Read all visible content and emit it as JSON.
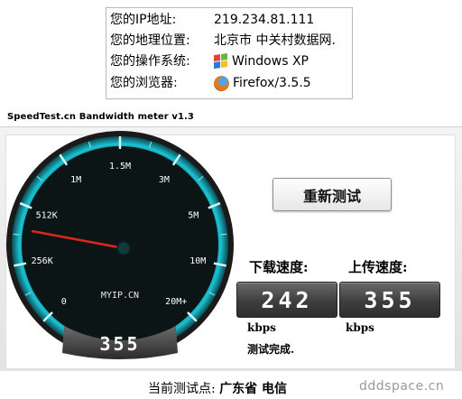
{
  "info": {
    "ip_label": "您的IP地址:",
    "ip_value": "219.234.81.111",
    "location_label": "您的地理位置:",
    "location_value": "北京市 中关村数据网.",
    "os_label": "您的操作系统:",
    "os_value": "Windows XP",
    "os_icon": "windows-logo-icon",
    "browser_label": "您的浏览器:",
    "browser_value": "Firefox/3.5.5",
    "browser_icon": "firefox-logo-icon"
  },
  "speedtest": {
    "title": "SpeedTest.cn Bandwidth meter v1.3",
    "gauge": {
      "scale_labels": [
        "0",
        "256K",
        "512K",
        "1M",
        "1.5M",
        "3M",
        "5M",
        "10M",
        "20M+"
      ],
      "center_text": "MYIP.CN",
      "readout": "355",
      "needle_position": "256K"
    },
    "retest_label": "重新测试",
    "download_label": "下载速度:",
    "upload_label": "上传速度:",
    "download_value": "242",
    "upload_value": "355",
    "download_unit": "kbps",
    "upload_unit": "kbps",
    "status": "测试完成."
  },
  "footer": {
    "node_label": "当前测试点:",
    "node_value": "广东省 电信",
    "watermark": "dddspace.cn"
  },
  "colors": {
    "gauge_ring": "#19b8c8",
    "gauge_face": "#0c1516",
    "needle": "#e0251b",
    "display": "#3e3e3e"
  }
}
